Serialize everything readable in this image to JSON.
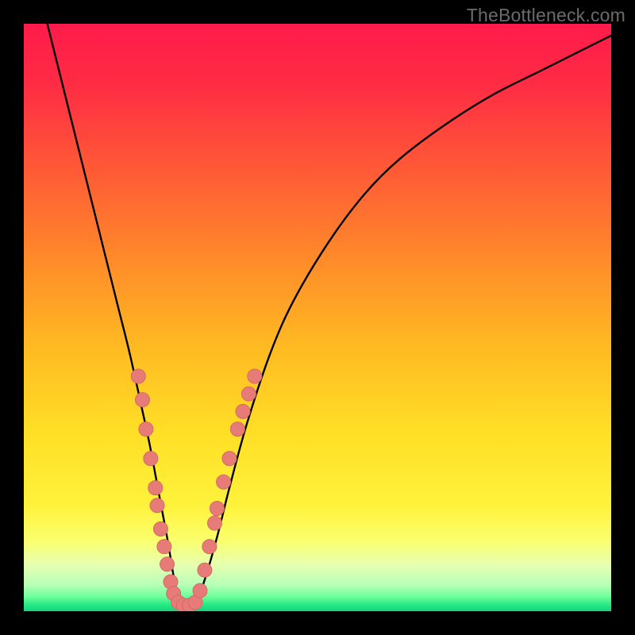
{
  "watermark": "TheBottleneck.com",
  "colors": {
    "black": "#000000",
    "curve": "#000000",
    "dot_fill": "#e77b77",
    "dot_stroke": "#d46a66",
    "gradient_stops": [
      {
        "offset": 0.0,
        "color": "#ff1b4b"
      },
      {
        "offset": 0.1,
        "color": "#ff2b44"
      },
      {
        "offset": 0.25,
        "color": "#ff5a36"
      },
      {
        "offset": 0.4,
        "color": "#ff8a2a"
      },
      {
        "offset": 0.55,
        "color": "#ffba22"
      },
      {
        "offset": 0.7,
        "color": "#ffe026"
      },
      {
        "offset": 0.82,
        "color": "#fff23c"
      },
      {
        "offset": 0.88,
        "color": "#fbff6d"
      },
      {
        "offset": 0.92,
        "color": "#e8ffb0"
      },
      {
        "offset": 0.955,
        "color": "#b8ffb8"
      },
      {
        "offset": 0.975,
        "color": "#6fff9a"
      },
      {
        "offset": 0.99,
        "color": "#22e885"
      },
      {
        "offset": 1.0,
        "color": "#17d47a"
      }
    ]
  },
  "chart_data": {
    "type": "line",
    "title": "",
    "xlabel": "",
    "ylabel": "",
    "xlim": [
      0,
      100
    ],
    "ylim": [
      0,
      100
    ],
    "grid": false,
    "series": [
      {
        "name": "bottleneck-curve",
        "x": [
          4,
          6,
          8,
          10,
          12,
          14,
          16,
          18,
          20,
          21.5,
          23,
          24.5,
          25.5,
          26.5,
          28,
          29.5,
          31,
          33,
          35,
          38,
          42,
          46,
          52,
          58,
          64,
          72,
          80,
          88,
          96,
          100
        ],
        "y": [
          100,
          92,
          84,
          76,
          68,
          60,
          52,
          44,
          35,
          28,
          20,
          12,
          6,
          2,
          1,
          2,
          6,
          13,
          21,
          32,
          44,
          53,
          63,
          71,
          77,
          83,
          88,
          92,
          96,
          98
        ]
      }
    ],
    "dots": [
      {
        "x": 19.5,
        "y": 40
      },
      {
        "x": 20.2,
        "y": 36
      },
      {
        "x": 20.8,
        "y": 31
      },
      {
        "x": 21.6,
        "y": 26
      },
      {
        "x": 22.4,
        "y": 21
      },
      {
        "x": 22.7,
        "y": 18
      },
      {
        "x": 23.3,
        "y": 14
      },
      {
        "x": 23.9,
        "y": 11
      },
      {
        "x": 24.4,
        "y": 8
      },
      {
        "x": 25.0,
        "y": 5
      },
      {
        "x": 25.5,
        "y": 3
      },
      {
        "x": 26.3,
        "y": 1.5
      },
      {
        "x": 27.2,
        "y": 1
      },
      {
        "x": 28.2,
        "y": 1
      },
      {
        "x": 29.2,
        "y": 1.5
      },
      {
        "x": 30.0,
        "y": 3.5
      },
      {
        "x": 30.8,
        "y": 7
      },
      {
        "x": 31.6,
        "y": 11
      },
      {
        "x": 32.5,
        "y": 15
      },
      {
        "x": 32.9,
        "y": 17.5
      },
      {
        "x": 34.0,
        "y": 22
      },
      {
        "x": 35.0,
        "y": 26
      },
      {
        "x": 36.4,
        "y": 31
      },
      {
        "x": 37.3,
        "y": 34
      },
      {
        "x": 38.3,
        "y": 37
      },
      {
        "x": 39.3,
        "y": 40
      }
    ]
  }
}
